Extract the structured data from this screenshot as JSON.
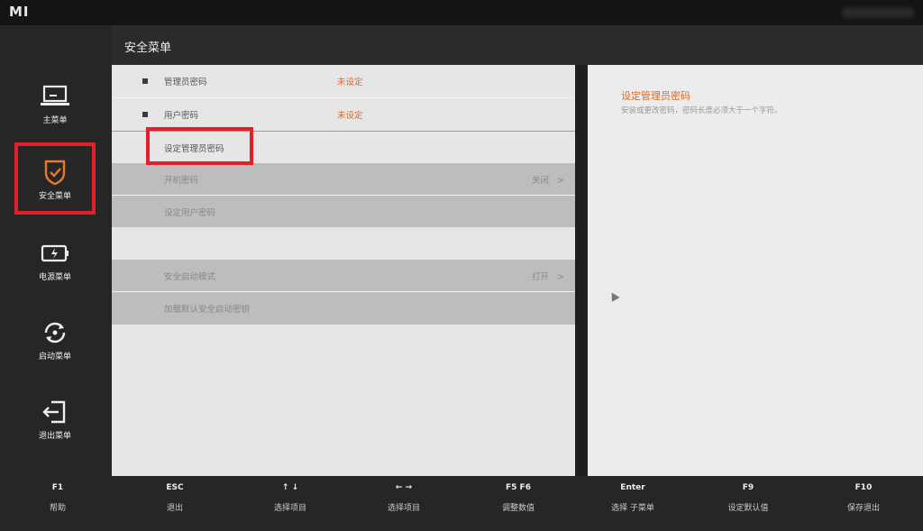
{
  "brand": {
    "logo": "MI"
  },
  "sidebar": {
    "items": [
      {
        "label": "主菜单",
        "icon": "laptop-icon"
      },
      {
        "label": "安全菜单",
        "icon": "shield-check-icon",
        "active": true
      },
      {
        "label": "电源菜单",
        "icon": "battery-icon"
      },
      {
        "label": "启动菜单",
        "icon": "reboot-icon"
      },
      {
        "label": "退出菜单",
        "icon": "exit-icon"
      }
    ]
  },
  "header": {
    "title": "安全菜单"
  },
  "menu": {
    "rows": [
      {
        "label": "管理员密码",
        "value": "未设定"
      },
      {
        "label": "用户密码",
        "value": "未设定"
      },
      {
        "label": "设定管理员密码"
      },
      {
        "label": "开机密码",
        "value": "关闭",
        "chevron": ">"
      },
      {
        "label": "设定用户密码"
      },
      {
        "label": ""
      },
      {
        "label": "安全启动模式",
        "value": "打开",
        "chevron": ">"
      },
      {
        "label": "加载默认安全启动密钥"
      }
    ]
  },
  "description": {
    "title": "设定管理员密码",
    "text": "安装或更改密码，密码长度必须大于一个字符。"
  },
  "footer": {
    "keys": [
      {
        "key": "F1",
        "desc": "帮助"
      },
      {
        "key": "ESC",
        "desc": "退出"
      },
      {
        "key": "↑ ↓",
        "desc": "选择项目"
      },
      {
        "key": "← →",
        "desc": "选择项目"
      },
      {
        "key": "F5  F6",
        "desc": "调整数值"
      },
      {
        "key": "Enter",
        "desc": "选择 子菜单"
      },
      {
        "key": "F9",
        "desc": "设定默认值"
      },
      {
        "key": "F10",
        "desc": "保存退出"
      }
    ]
  },
  "colors": {
    "accent": "#d86a2c",
    "highlight": "#e0202a"
  }
}
